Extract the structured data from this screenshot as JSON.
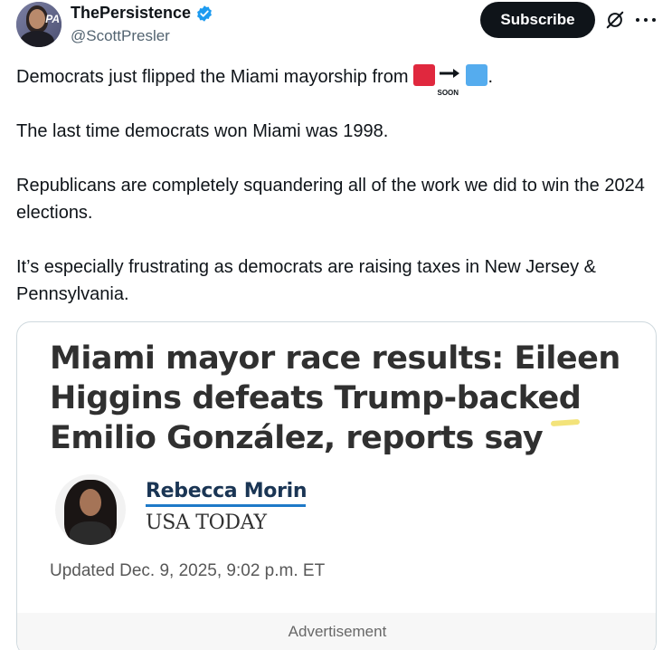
{
  "account": {
    "display_name": "ThePersistence",
    "handle": "@ScottPresler",
    "avatar_badge": "PA"
  },
  "actions": {
    "subscribe_label": "Subscribe",
    "grok_icon": "grok-icon",
    "more_icon": "more-icon"
  },
  "tweet": {
    "line1_before": "Democrats just flipped the Miami mayorship from",
    "line1_emoji_soon": "SOON",
    "line1_after": ".",
    "paragraph2": "The last time democrats won Miami was 1998.",
    "paragraph3": "Republicans are completely squandering all of the work we did to win the 2024 elections.",
    "paragraph4": "It’s especially frustrating as democrats are raising taxes in New Jersey & Pennsylvania."
  },
  "card": {
    "headline": "Miami mayor race results: Eileen Higgins defeats Trump-backed Emilio González, reports say",
    "author": "Rebecca Morin",
    "publication": "USA TODAY",
    "updated": "Updated Dec. 9, 2025, 9:02 p.m. ET",
    "advertisement_label": "Advertisement"
  },
  "colors": {
    "verified": "#1d9bf0",
    "subscribe_bg": "#0f1419",
    "emoji_red": "#e0283e",
    "emoji_blue": "#55acee",
    "author_link": "#1a3554",
    "author_underline": "#1e79c8"
  }
}
